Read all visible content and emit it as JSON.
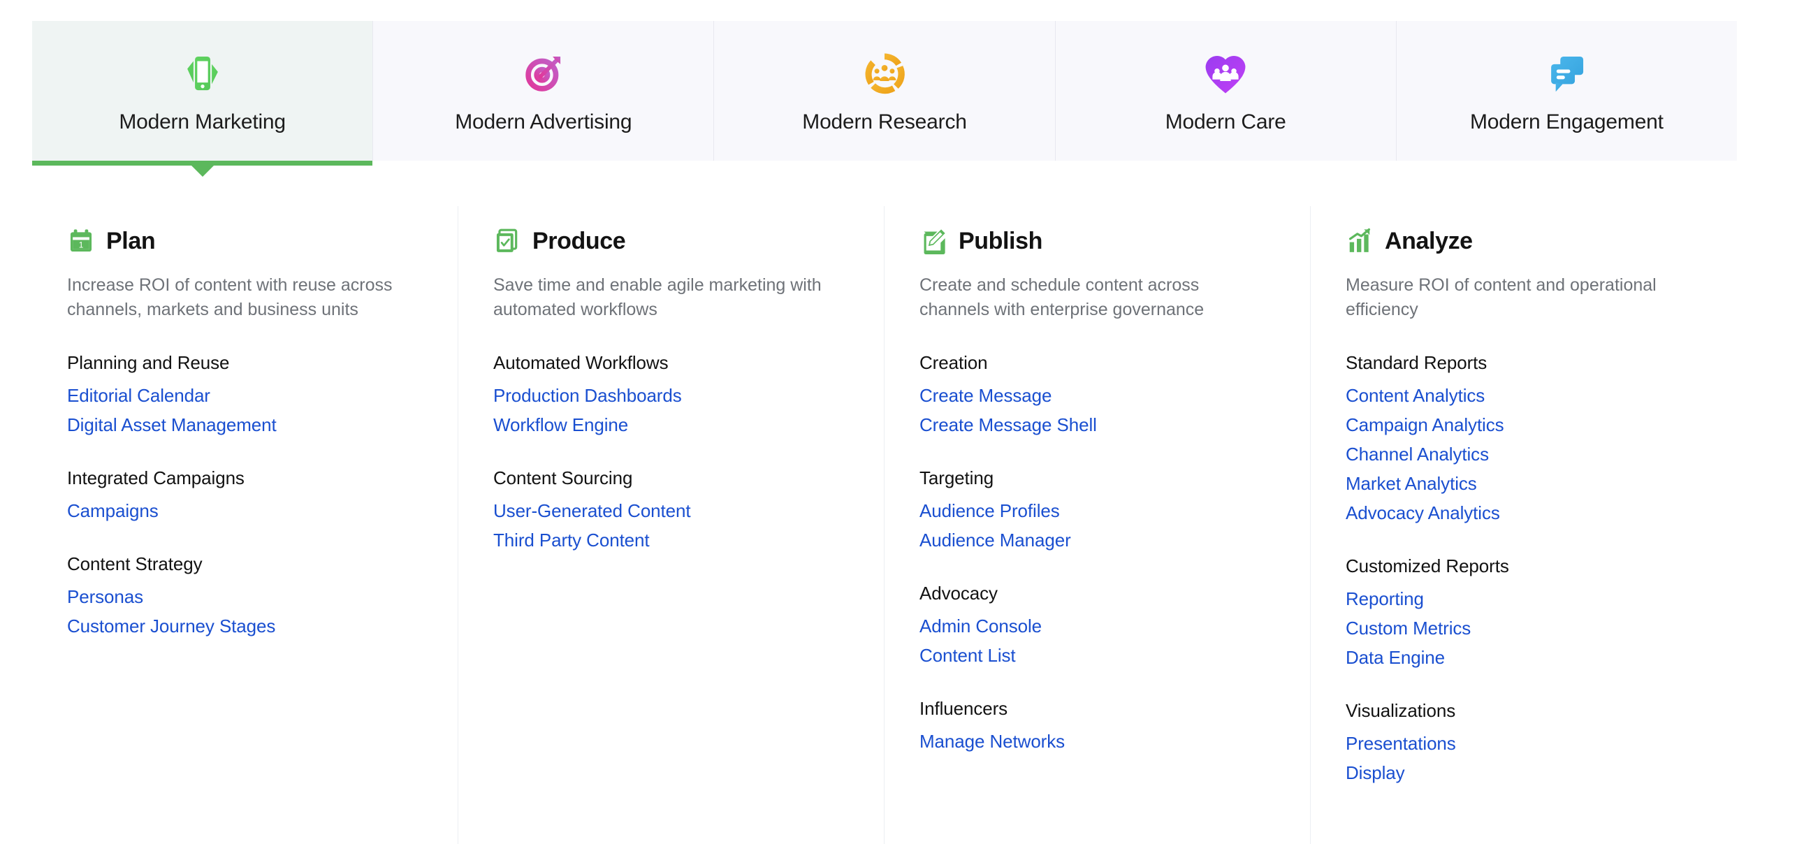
{
  "tabs": [
    {
      "label": "Modern Marketing",
      "icon": "mobile-phone-icon",
      "active": true,
      "accent": "#5cb85c"
    },
    {
      "label": "Modern Advertising",
      "icon": "target-arrow-icon",
      "active": false,
      "accent": "#d94d9e"
    },
    {
      "label": "Modern Research",
      "icon": "people-cycle-icon",
      "active": false,
      "accent": "#f0a82a"
    },
    {
      "label": "Modern Care",
      "icon": "heart-people-icon",
      "active": false,
      "accent": "#a22ef0"
    },
    {
      "label": "Modern Engagement",
      "icon": "chat-bubbles-icon",
      "active": false,
      "accent": "#3bb0e8"
    }
  ],
  "active_tab_underline_color": "#5cb85c",
  "link_color": "#1a4fd0",
  "panel_icon_color": "#5cb85c",
  "panels": [
    {
      "title": "Plan",
      "icon": "calendar-icon",
      "description": "Increase ROI of content with reuse across channels, markets and business units",
      "groups": [
        {
          "title": "Planning and Reuse",
          "links": [
            "Editorial Calendar",
            "Digital Asset Management"
          ]
        },
        {
          "title": "Integrated Campaigns",
          "links": [
            "Campaigns"
          ]
        },
        {
          "title": "Content Strategy",
          "links": [
            "Personas",
            "Customer Journey Stages"
          ]
        }
      ]
    },
    {
      "title": "Produce",
      "icon": "checklist-icon",
      "description": "Save time and enable agile marketing with automated workflows",
      "groups": [
        {
          "title": "Automated Workflows",
          "links": [
            "Production Dashboards",
            "Workflow Engine"
          ]
        },
        {
          "title": "Content Sourcing",
          "links": [
            "User-Generated Content",
            "Third Party Content"
          ]
        }
      ]
    },
    {
      "title": "Publish",
      "icon": "pencil-square-icon",
      "description": "Create and schedule content across channels with enterprise governance",
      "groups": [
        {
          "title": "Creation",
          "links": [
            "Create Message",
            "Create Message Shell"
          ]
        },
        {
          "title": "Targeting",
          "links": [
            "Audience Profiles",
            "Audience Manager"
          ]
        },
        {
          "title": "Advocacy",
          "links": [
            "Admin Console",
            "Content List"
          ]
        },
        {
          "title": "Influencers",
          "links": [
            "Manage Networks"
          ]
        }
      ]
    },
    {
      "title": "Analyze",
      "icon": "bar-chart-icon",
      "description": "Measure ROI of content and operational efficiency",
      "groups": [
        {
          "title": "Standard Reports",
          "links": [
            "Content Analytics",
            "Campaign Analytics",
            "Channel Analytics",
            "Market Analytics",
            "Advocacy Analytics"
          ]
        },
        {
          "title": "Customized Reports",
          "links": [
            "Reporting",
            "Custom Metrics",
            "Data Engine"
          ]
        },
        {
          "title": "Visualizations",
          "links": [
            "Presentations",
            "Display"
          ]
        }
      ]
    }
  ]
}
